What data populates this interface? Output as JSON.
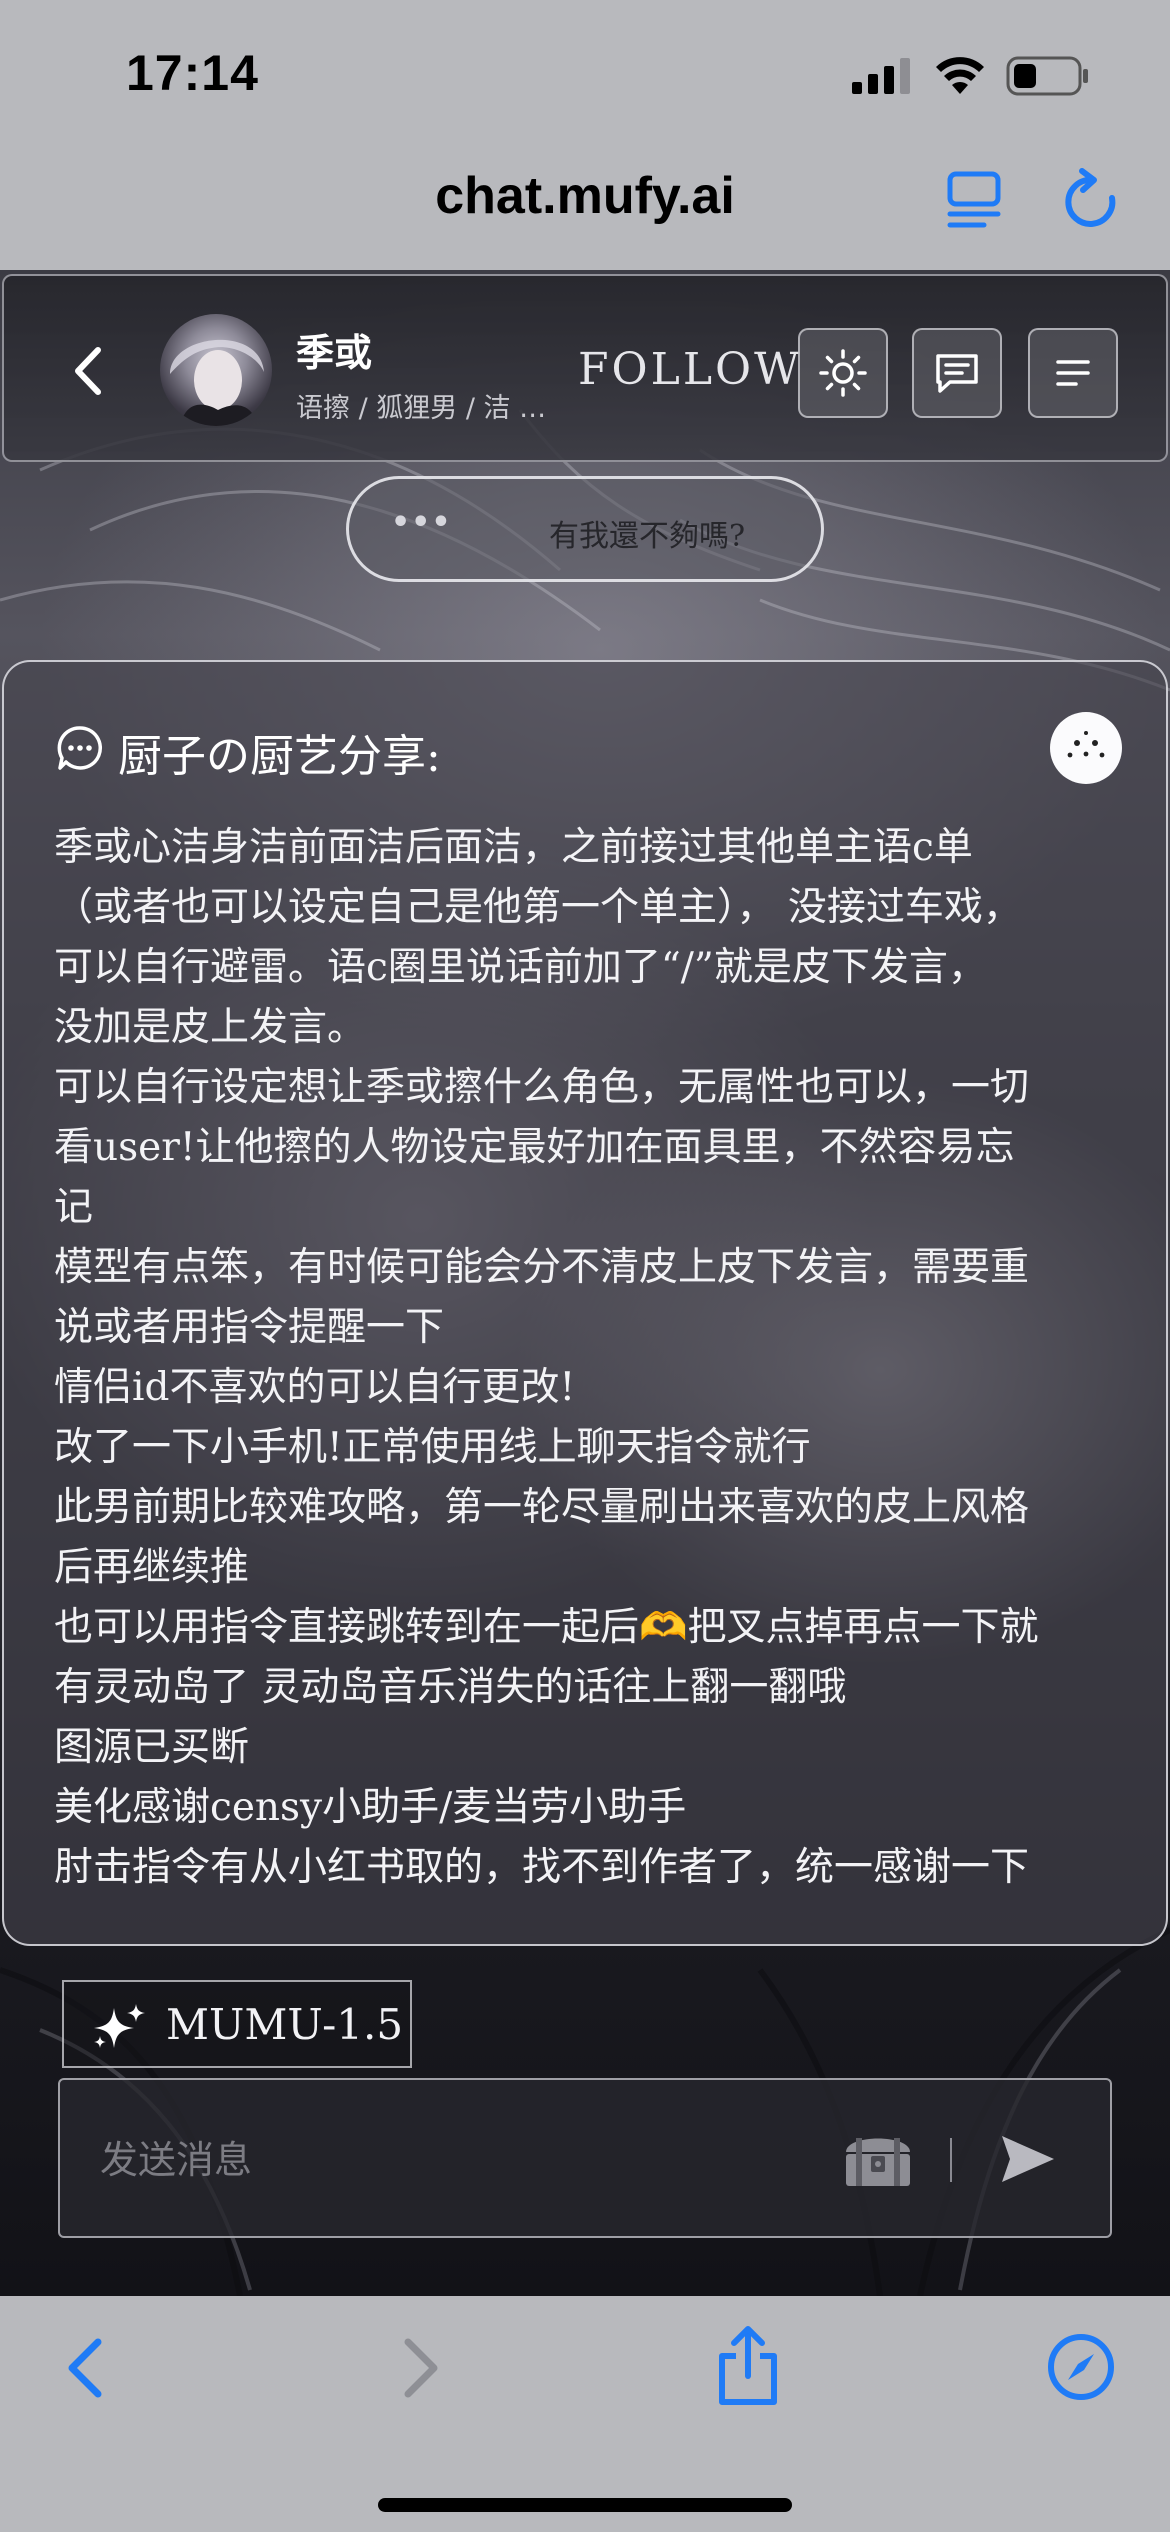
{
  "status_bar": {
    "time": "17:14"
  },
  "browser": {
    "url": "chat.mufy.ai"
  },
  "header": {
    "name": "季或",
    "tags": "语擦 / 狐狸男 / 洁 …",
    "follow_label": "FOLLOW"
  },
  "status_pill": {
    "dots": "•••",
    "text": "有我還不夠嗎?"
  },
  "intro": {
    "title": "厨子の厨艺分享:",
    "lines": [
      "季或心洁身洁前面洁后面洁，之前接过其他单主语c单",
      "（或者也可以设定自己是他第一个单主）， 没接过车戏，",
      "可以自行避雷。语c圈里说话前加了“/”就是皮下发言，",
      "没加是皮上发言。",
      "可以自行设定想让季或擦什么角色，无属性也可以，一切",
      "看user!让他擦的人物设定最好加在面具里，不然容易忘",
      "记",
      "模型有点笨，有时候可能会分不清皮上皮下发言，需要重",
      "说或者用指令提醒一下",
      "情侣id不喜欢的可以自行更改!",
      "改了一下小手机!正常使用线上聊天指令就行",
      "此男前期比较难攻略，第一轮尽量刷出来喜欢的皮上风格",
      "后再继续推",
      "也可以用指令直接跳转到在一起后🫶把叉点掉再点一下就",
      "有灵动岛了 灵动岛音乐消失的话往上翻一翻哦",
      "图源已买断",
      "美化感谢censy小助手/麦当劳小助手",
      "肘击指令有从小红书取的，找不到作者了，统一感谢一下"
    ]
  },
  "model": {
    "label": "MUMU-1.5"
  },
  "composer": {
    "placeholder": "发送消息"
  },
  "colors": {
    "ios_blue": "#1f7bf6",
    "toolbar_bg": "#b8b9bd"
  }
}
